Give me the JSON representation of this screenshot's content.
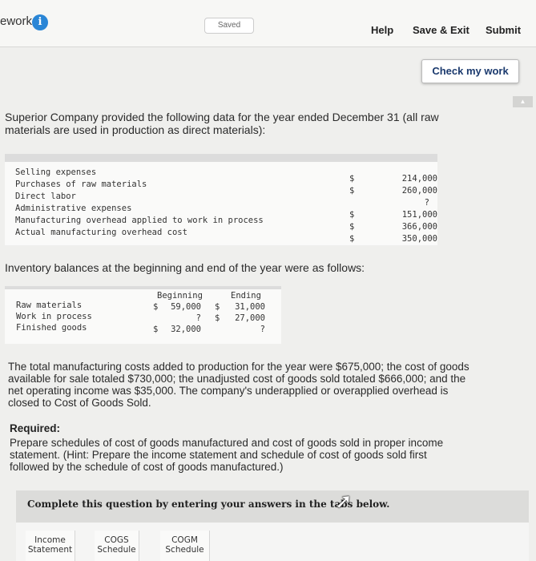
{
  "header": {
    "app_title": "ework",
    "saved_status": "Saved",
    "help_label": "Help",
    "save_exit_label": "Save & Exit",
    "submit_label": "Submit",
    "check_label": "Check my work"
  },
  "problem": {
    "intro": "Superior Company provided the following data for the year ended December 31 (all raw materials are used in production as direct materials):",
    "expenses": [
      {
        "label": "Selling expenses",
        "currency": "$",
        "value": "214,000"
      },
      {
        "label": "Purchases of raw materials",
        "currency": "$",
        "value": "260,000"
      },
      {
        "label": "Direct labor",
        "currency": "",
        "value": "?"
      },
      {
        "label": "Administrative expenses",
        "currency": "$",
        "value": "151,000"
      },
      {
        "label": "Manufacturing overhead applied to work in process",
        "currency": "$",
        "value": "366,000"
      },
      {
        "label": "Actual manufacturing overhead cost",
        "currency": "$",
        "value": "350,000"
      }
    ],
    "inventory_heading": "Inventory balances at the beginning and end of the year were as follows:",
    "inventory_columns": {
      "beginning": "Beginning",
      "ending": "Ending"
    },
    "inventory": [
      {
        "label": "Raw materials",
        "beg_cur": "$",
        "beg": "59,000",
        "end_cur": "$",
        "end": "31,000"
      },
      {
        "label": "Work in process",
        "beg_cur": "",
        "beg": "?",
        "end_cur": "$",
        "end": "27,000"
      },
      {
        "label": "Finished goods",
        "beg_cur": "$",
        "beg": "32,000",
        "end_cur": "",
        "end": "?"
      }
    ],
    "summary": "The total manufacturing costs added to production for the year were $675,000; the cost of goods available for sale totaled $730,000; the unadjusted cost of goods sold totaled $666,000; and the net operating income was $35,000. The company's underapplied or overapplied overhead is closed to Cost of Goods Sold.",
    "required_title": "Required:",
    "required_text": "Prepare schedules of cost of goods manufactured and cost of goods sold in proper income statement. (Hint: Prepare the income statement and schedule of cost of goods sold first followed by the schedule of cost of goods manufactured.)",
    "complete_instruction": "Complete this question by entering your answers in the tabs below."
  },
  "tabs": [
    {
      "line1": "Income",
      "line2": "Statement"
    },
    {
      "line1": "COGS",
      "line2": "Schedule"
    },
    {
      "line1": "COGM",
      "line2": "Schedule"
    }
  ],
  "colors": {
    "accent": "#2a86d6",
    "check_text": "#1b3a6e"
  },
  "icons": [
    "info-icon",
    "cursor-icon",
    "scroll-up-icon"
  ]
}
